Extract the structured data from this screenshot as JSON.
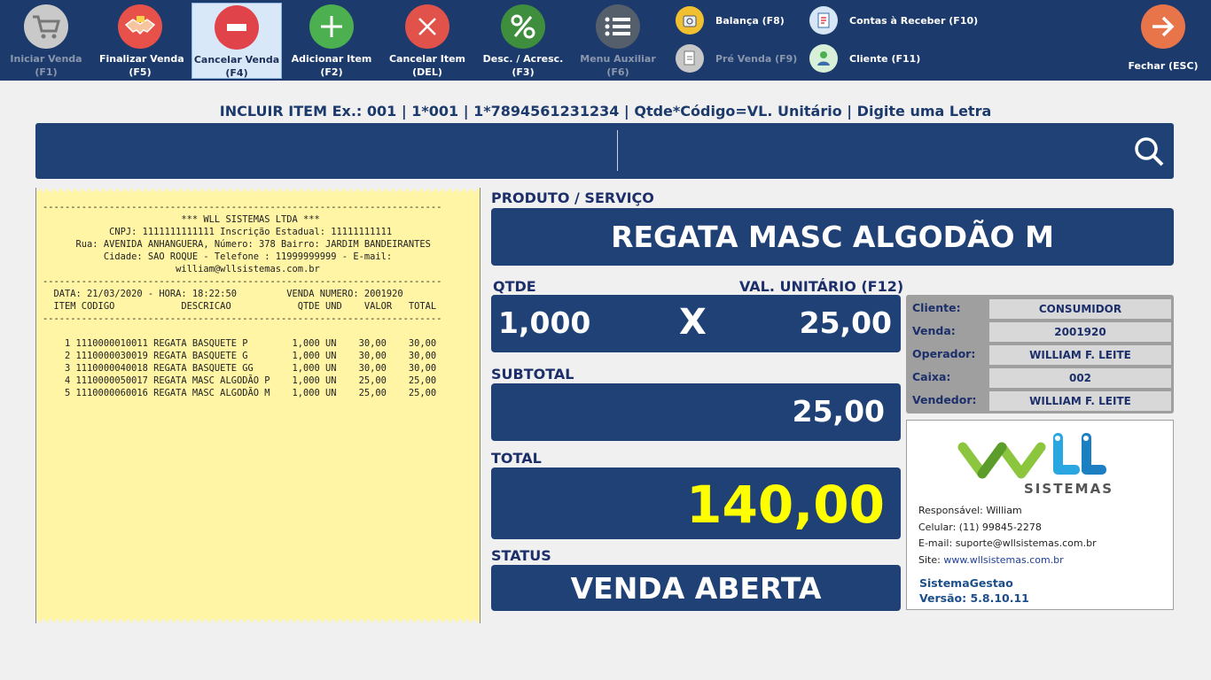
{
  "toolbar": {
    "buttons": [
      {
        "label": "Iniciar Venda",
        "key": "(F1)"
      },
      {
        "label": "Finalizar Venda",
        "key": "(F5)"
      },
      {
        "label": "Cancelar Venda",
        "key": "(F4)"
      },
      {
        "label": "Adicionar Item",
        "key": "(F2)"
      },
      {
        "label": "Cancelar Item",
        "key": "(DEL)"
      },
      {
        "label": "Desc. / Acresc.",
        "key": "(F3)"
      },
      {
        "label": "Menu Auxiliar",
        "key": "(F6)"
      }
    ],
    "small": [
      {
        "label": "Balança (F8)"
      },
      {
        "label": "Pré Venda (F9)"
      },
      {
        "label": "Contas à Receber (F10)"
      },
      {
        "label": "Cliente (F11)"
      }
    ],
    "close": {
      "label": "Fechar (ESC)"
    }
  },
  "include_hint": "INCLUIR ITEM Ex.:  001   |   1*001   |   1*7894561231234   |   Qtde*Código=VL. Unitário   |   Digite uma Letra",
  "search": {
    "value": "",
    "placeholder": ""
  },
  "receipt": {
    "lines": [
      "------------------------------------------------------------------------",
      "                         *** WLL SISTEMAS LTDA ***",
      "            CNPJ: 1111111111111 Inscrição Estadual: 11111111111",
      "      Rua: AVENIDA ANHANGUERA, Número: 378 Bairro: JARDIM BANDEIRANTES",
      "           Cidade: SAO ROQUE - Telefone : 11999999999 - E-mail:",
      "                        william@wllsistemas.com.br",
      "------------------------------------------------------------------------",
      "  DATA: 21/03/2020 - HORA: 18:22:50         VENDA NUMERO: 2001920",
      "  ITEM CODIGO            DESCRICAO            QTDE UND    VALOR   TOTAL",
      "------------------------------------------------------------------------",
      "",
      "    1 1110000010011 REGATA BASQUETE P        1,000 UN    30,00    30,00",
      "    2 1110000030019 REGATA BASQUETE G        1,000 UN    30,00    30,00",
      "    3 1110000040018 REGATA BASQUETE GG       1,000 UN    30,00    30,00",
      "    4 1110000050017 REGATA MASC ALGODÃO P    1,000 UN    25,00    25,00",
      "    5 1110000060016 REGATA MASC ALGODÃO M    1,000 UN    25,00    25,00"
    ]
  },
  "labels": {
    "product": "PRODUTO / SERVIÇO",
    "qty": "QTDE",
    "unit_value": "VAL. UNITÁRIO (F12)",
    "subtotal": "SUBTOTAL",
    "total": "TOTAL",
    "status": "STATUS"
  },
  "product_name": "REGATA MASC ALGODÃO M",
  "qty_value": "1,000",
  "times": "X",
  "unit_value": "25,00",
  "subtotal_value": "25,00",
  "total_value": "140,00",
  "status_value": "VENDA ABERTA",
  "info": {
    "rows": [
      {
        "key": "Cliente:",
        "value": "CONSUMIDOR"
      },
      {
        "key": "Venda:",
        "value": "2001920"
      },
      {
        "key": "Operador:",
        "value": "WILLIAM F. LEITE"
      },
      {
        "key": "Caixa:",
        "value": "002"
      },
      {
        "key": "Vendedor:",
        "value": "WILLIAM F. LEITE"
      }
    ]
  },
  "company": {
    "logo_text": "SISTEMAS",
    "responsavel": "Responsável: William",
    "celular": "Celular: (11) 99845-2278",
    "email": "E-mail: suporte@wllsistemas.com.br",
    "site_label": "Site:",
    "site_url": "www.wllsistemas.com.br",
    "system_name": "SistemaGestao",
    "version": "Versão: 5.8.10.11"
  },
  "colors": {
    "toolbar_bg": "#1c3a6c",
    "panel_bg": "#1f4175",
    "total_text": "#ffff00",
    "receipt_bg": "#fff5a5"
  }
}
